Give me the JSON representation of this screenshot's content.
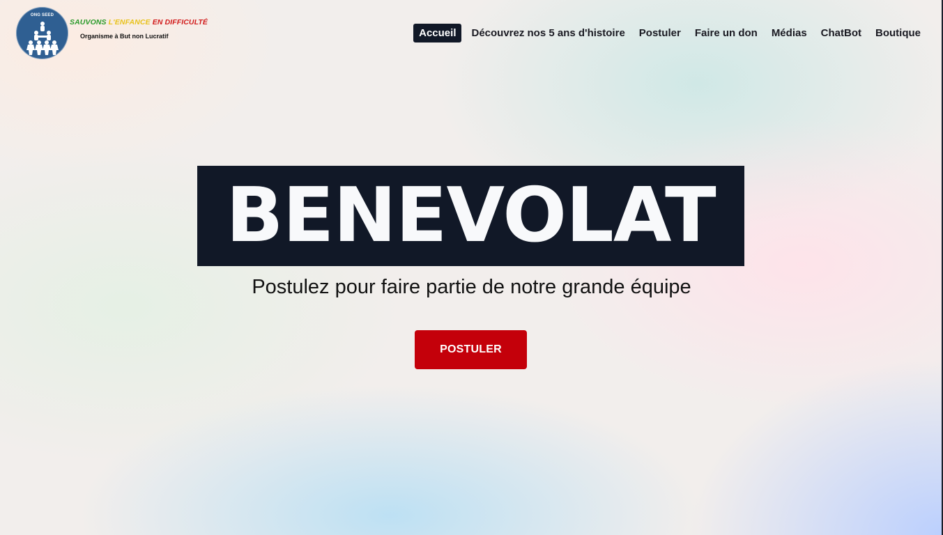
{
  "header": {
    "logo": {
      "badge_text": "ONG SEED",
      "icon": "human-pyramid-icon"
    },
    "brand": {
      "word1": "SAUVONS",
      "word2": "L'ENFANCE",
      "word3": "EN DIFFICULTÉ",
      "tagline": "Organisme à But non Lucratif"
    },
    "nav": {
      "items": [
        {
          "label": "Accueil",
          "active": true
        },
        {
          "label": "Découvrez nos 5 ans d'histoire"
        },
        {
          "label": "Postuler"
        },
        {
          "label": "Faire un don"
        },
        {
          "label": "Médias"
        },
        {
          "label": "ChatBot"
        },
        {
          "label": "Boutique"
        }
      ]
    }
  },
  "hero": {
    "title": "BENEVOLAT",
    "subtitle": "Postulez pour faire partie de notre grande équipe",
    "cta_label": "POSTULER"
  },
  "colors": {
    "brand_navy": "#111827",
    "cta_red": "#c4000a",
    "logo_blue": "#2f5f92",
    "green": "#2a9a2a",
    "yellow": "#e8c21c",
    "red": "#d11a1a"
  }
}
